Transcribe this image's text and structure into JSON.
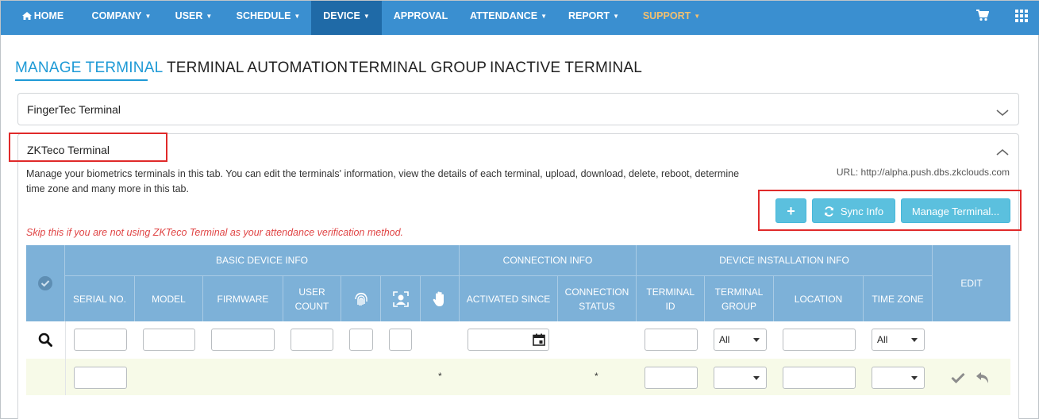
{
  "nav": {
    "home": "HOME",
    "company": "COMPANY",
    "user": "USER",
    "schedule": "SCHEDULE",
    "device": "DEVICE",
    "approval": "APPROVAL",
    "attendance": "ATTENDANCE",
    "report": "REPORT",
    "support": "SUPPORT",
    "caret": "▼"
  },
  "tabs": {
    "manage": "MANAGE TERMINAL",
    "automation": "TERMINAL AUTOMATION",
    "group": "TERMINAL GROUP",
    "inactive": "INACTIVE TERMINAL"
  },
  "panels": {
    "fingertec_title": "FingerTec Terminal",
    "zkteco_title": "ZKTeco Terminal",
    "description": "Manage your biometrics terminals in this tab. You can edit the terminals' information, view the details of each terminal, upload, download, delete, reboot, determine time zone and many more in this tab.",
    "url": "URL: http://alpha.push.dbs.zkclouds.com",
    "warning": "Skip this if you are not using ZKTeco Terminal as your attendance verification method."
  },
  "buttons": {
    "add": "+",
    "sync": "Sync Info",
    "manage": "Manage Terminal..."
  },
  "table": {
    "groups": {
      "basic": "BASIC DEVICE INFO",
      "connection": "CONNECTION INFO",
      "installation": "DEVICE INSTALLATION INFO",
      "edit": "EDIT"
    },
    "columns": {
      "serial": "SERIAL NO.",
      "model": "MODEL",
      "firmware": "FIRMWARE",
      "user_count": "USER COUNT",
      "activated": "ACTIVATED SINCE",
      "conn_status": "CONNECTION STATUS",
      "terminal_id": "TERMINAL ID",
      "terminal_group": "TERMINAL GROUP",
      "location": "LOCATION",
      "time_zone": "TIME ZONE"
    },
    "filters": {
      "group_value": "All",
      "timezone_value": "All"
    },
    "required_mark": "*"
  },
  "colors": {
    "navbar": "#3a8fd0",
    "nav_active": "#1f6aa7",
    "support": "#f3c06f",
    "accent": "#1e9ad6",
    "header": "#7db1d8",
    "button": "#5bc0de",
    "warning": "#e04545",
    "highlight_box": "#e02a2a"
  }
}
